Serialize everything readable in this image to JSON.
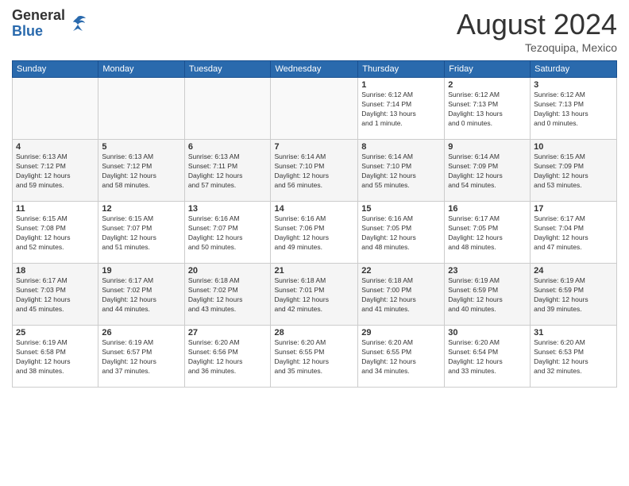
{
  "logo": {
    "general": "General",
    "blue": "Blue"
  },
  "title": {
    "month_year": "August 2024",
    "location": "Tezoquipa, Mexico"
  },
  "days_of_week": [
    "Sunday",
    "Monday",
    "Tuesday",
    "Wednesday",
    "Thursday",
    "Friday",
    "Saturday"
  ],
  "weeks": [
    {
      "days": [
        {
          "num": "",
          "info": ""
        },
        {
          "num": "",
          "info": ""
        },
        {
          "num": "",
          "info": ""
        },
        {
          "num": "",
          "info": ""
        },
        {
          "num": "1",
          "info": "Sunrise: 6:12 AM\nSunset: 7:14 PM\nDaylight: 13 hours\nand 1 minute."
        },
        {
          "num": "2",
          "info": "Sunrise: 6:12 AM\nSunset: 7:13 PM\nDaylight: 13 hours\nand 0 minutes."
        },
        {
          "num": "3",
          "info": "Sunrise: 6:12 AM\nSunset: 7:13 PM\nDaylight: 13 hours\nand 0 minutes."
        }
      ]
    },
    {
      "days": [
        {
          "num": "4",
          "info": "Sunrise: 6:13 AM\nSunset: 7:12 PM\nDaylight: 12 hours\nand 59 minutes."
        },
        {
          "num": "5",
          "info": "Sunrise: 6:13 AM\nSunset: 7:12 PM\nDaylight: 12 hours\nand 58 minutes."
        },
        {
          "num": "6",
          "info": "Sunrise: 6:13 AM\nSunset: 7:11 PM\nDaylight: 12 hours\nand 57 minutes."
        },
        {
          "num": "7",
          "info": "Sunrise: 6:14 AM\nSunset: 7:10 PM\nDaylight: 12 hours\nand 56 minutes."
        },
        {
          "num": "8",
          "info": "Sunrise: 6:14 AM\nSunset: 7:10 PM\nDaylight: 12 hours\nand 55 minutes."
        },
        {
          "num": "9",
          "info": "Sunrise: 6:14 AM\nSunset: 7:09 PM\nDaylight: 12 hours\nand 54 minutes."
        },
        {
          "num": "10",
          "info": "Sunrise: 6:15 AM\nSunset: 7:09 PM\nDaylight: 12 hours\nand 53 minutes."
        }
      ]
    },
    {
      "days": [
        {
          "num": "11",
          "info": "Sunrise: 6:15 AM\nSunset: 7:08 PM\nDaylight: 12 hours\nand 52 minutes."
        },
        {
          "num": "12",
          "info": "Sunrise: 6:15 AM\nSunset: 7:07 PM\nDaylight: 12 hours\nand 51 minutes."
        },
        {
          "num": "13",
          "info": "Sunrise: 6:16 AM\nSunset: 7:07 PM\nDaylight: 12 hours\nand 50 minutes."
        },
        {
          "num": "14",
          "info": "Sunrise: 6:16 AM\nSunset: 7:06 PM\nDaylight: 12 hours\nand 49 minutes."
        },
        {
          "num": "15",
          "info": "Sunrise: 6:16 AM\nSunset: 7:05 PM\nDaylight: 12 hours\nand 48 minutes."
        },
        {
          "num": "16",
          "info": "Sunrise: 6:17 AM\nSunset: 7:05 PM\nDaylight: 12 hours\nand 48 minutes."
        },
        {
          "num": "17",
          "info": "Sunrise: 6:17 AM\nSunset: 7:04 PM\nDaylight: 12 hours\nand 47 minutes."
        }
      ]
    },
    {
      "days": [
        {
          "num": "18",
          "info": "Sunrise: 6:17 AM\nSunset: 7:03 PM\nDaylight: 12 hours\nand 45 minutes."
        },
        {
          "num": "19",
          "info": "Sunrise: 6:17 AM\nSunset: 7:02 PM\nDaylight: 12 hours\nand 44 minutes."
        },
        {
          "num": "20",
          "info": "Sunrise: 6:18 AM\nSunset: 7:02 PM\nDaylight: 12 hours\nand 43 minutes."
        },
        {
          "num": "21",
          "info": "Sunrise: 6:18 AM\nSunset: 7:01 PM\nDaylight: 12 hours\nand 42 minutes."
        },
        {
          "num": "22",
          "info": "Sunrise: 6:18 AM\nSunset: 7:00 PM\nDaylight: 12 hours\nand 41 minutes."
        },
        {
          "num": "23",
          "info": "Sunrise: 6:19 AM\nSunset: 6:59 PM\nDaylight: 12 hours\nand 40 minutes."
        },
        {
          "num": "24",
          "info": "Sunrise: 6:19 AM\nSunset: 6:59 PM\nDaylight: 12 hours\nand 39 minutes."
        }
      ]
    },
    {
      "days": [
        {
          "num": "25",
          "info": "Sunrise: 6:19 AM\nSunset: 6:58 PM\nDaylight: 12 hours\nand 38 minutes."
        },
        {
          "num": "26",
          "info": "Sunrise: 6:19 AM\nSunset: 6:57 PM\nDaylight: 12 hours\nand 37 minutes."
        },
        {
          "num": "27",
          "info": "Sunrise: 6:20 AM\nSunset: 6:56 PM\nDaylight: 12 hours\nand 36 minutes."
        },
        {
          "num": "28",
          "info": "Sunrise: 6:20 AM\nSunset: 6:55 PM\nDaylight: 12 hours\nand 35 minutes."
        },
        {
          "num": "29",
          "info": "Sunrise: 6:20 AM\nSunset: 6:55 PM\nDaylight: 12 hours\nand 34 minutes."
        },
        {
          "num": "30",
          "info": "Sunrise: 6:20 AM\nSunset: 6:54 PM\nDaylight: 12 hours\nand 33 minutes."
        },
        {
          "num": "31",
          "info": "Sunrise: 6:20 AM\nSunset: 6:53 PM\nDaylight: 12 hours\nand 32 minutes."
        }
      ]
    }
  ]
}
